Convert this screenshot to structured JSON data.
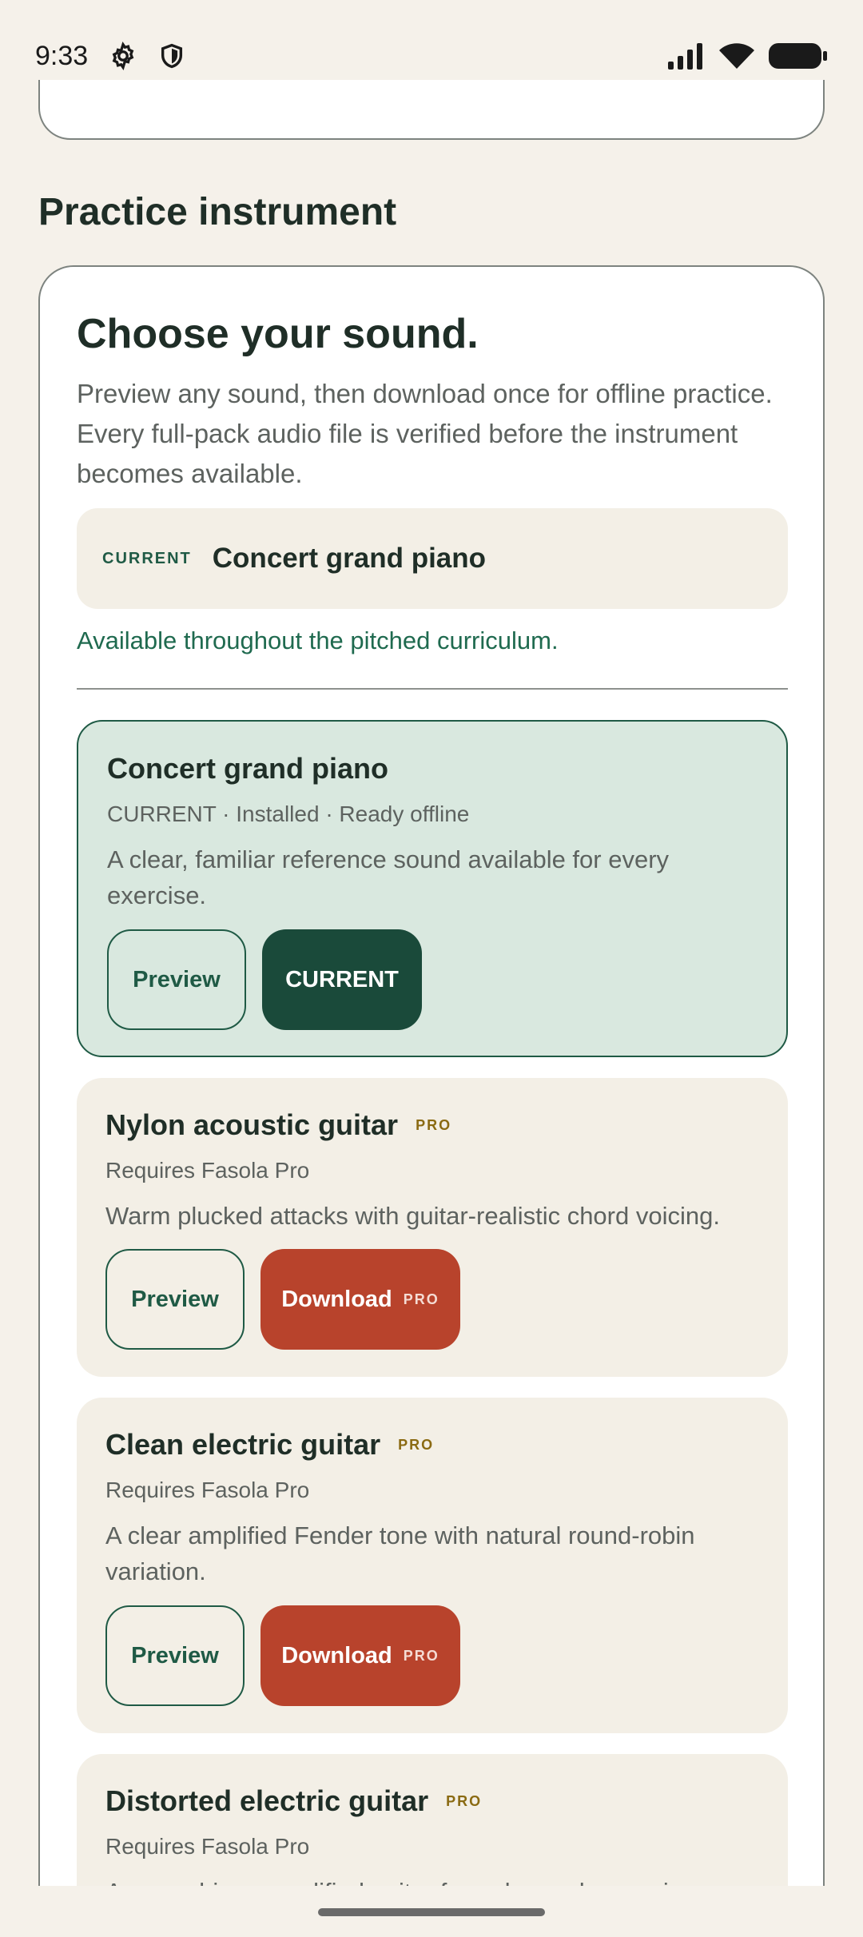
{
  "status_bar": {
    "time": "9:33",
    "icons": [
      "gear-icon",
      "shield-icon",
      "signal-icon",
      "wifi-icon",
      "battery-icon"
    ]
  },
  "section": {
    "title": "Practice instrument"
  },
  "card": {
    "title": "Choose your sound.",
    "description": "Preview any sound, then download once for offline practice. Every full-pack audio file is verified before the instrument becomes available.",
    "current": {
      "tag": "CURRENT",
      "name": "Concert grand piano"
    },
    "availability": "Available throughout the pitched curriculum."
  },
  "instruments": [
    {
      "name": "Concert grand piano",
      "pro": false,
      "status": "CURRENT · Installed · Ready offline",
      "description": "A clear, familiar reference sound available for every exercise.",
      "preview_label": "Preview",
      "action_label": "CURRENT"
    },
    {
      "name": "Nylon acoustic guitar",
      "pro": true,
      "pro_label": "PRO",
      "status": "Requires Fasola Pro",
      "description": "Warm plucked attacks with guitar-realistic chord voicing.",
      "preview_label": "Preview",
      "action_label": "Download",
      "action_badge": "PRO"
    },
    {
      "name": "Clean electric guitar",
      "pro": true,
      "pro_label": "PRO",
      "status": "Requires Fasola Pro",
      "description": "A clear amplified Fender tone with natural round-robin variation.",
      "preview_label": "Preview",
      "action_label": "Download",
      "action_badge": "PRO"
    },
    {
      "name": "Distorted electric guitar",
      "pro": true,
      "pro_label": "PRO",
      "status": "Requires Fasola Pro",
      "description": "An overdriven amplified guitar for a denser harmonic"
    }
  ],
  "colors": {
    "background": "#f5f1ea",
    "accent_green": "#1f5a45",
    "download_red": "#b8432c",
    "pro_gold": "#8a6a12"
  }
}
